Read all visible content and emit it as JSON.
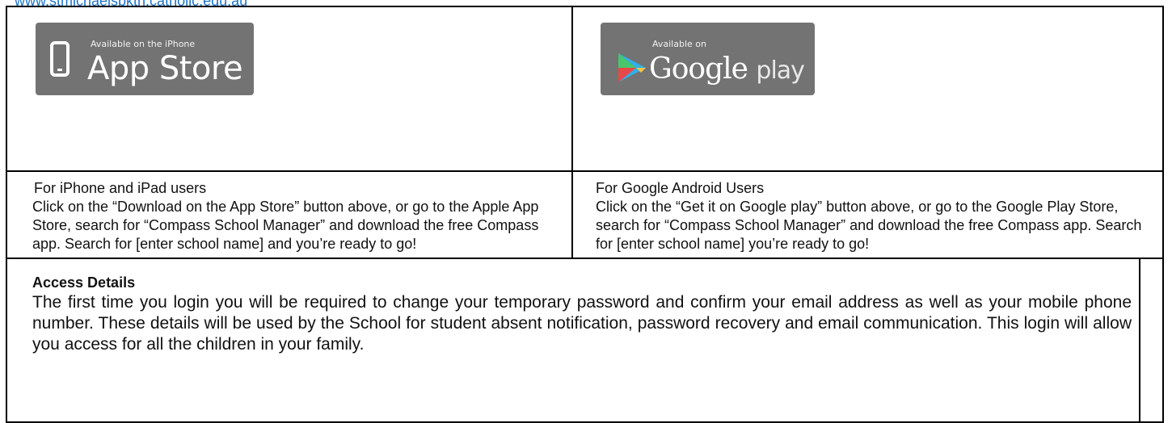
{
  "header": {
    "url_text": "www.stmichaelsbkth.catholic.edu.au"
  },
  "badges": {
    "appstore": {
      "small_text": "Available on the iPhone",
      "big_text": "App Store",
      "icon": "phone-icon"
    },
    "googleplay": {
      "small_text": "Available on",
      "big_text_main": "Google",
      "big_text_light": "play",
      "icon": "play-triangle-icon"
    }
  },
  "ios": {
    "heading": "For iPhone and iPad users",
    "body": "Click on the “Download on the App Store” button above, or go to the Apple App Store, search for “Compass School Manager” and download the free Compass app. Search for [enter school name] and you’re ready to go!"
  },
  "android": {
    "heading": "For Google Android Users",
    "body": "Click on the “Get it on Google play” button above, or go to the Google Play Store, search for “Compass School Manager” and download the free Compass app. Search for [enter school name] you’re ready to go!"
  },
  "access": {
    "title": "Access Details",
    "body": "The first time you login you will be required to change your temporary password and confirm your email address as well as your mobile phone number. These details will be used by the School for student absent notification, password recovery and email communication. This login will allow you access for all the children in your family."
  },
  "colors": {
    "link": "#1a73c8",
    "badge_bg": "#737373",
    "border": "#000000"
  }
}
